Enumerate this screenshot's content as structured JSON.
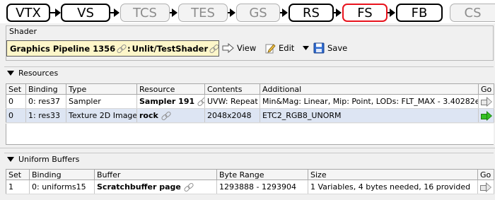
{
  "pipeline": {
    "stages": [
      {
        "label": "VTX",
        "state": "active"
      },
      {
        "label": "VS",
        "state": "active"
      },
      {
        "label": "TCS",
        "state": "inactive"
      },
      {
        "label": "TES",
        "state": "inactive"
      },
      {
        "label": "GS",
        "state": "inactive"
      },
      {
        "label": "RS",
        "state": "active"
      },
      {
        "label": "FS",
        "state": "selected"
      },
      {
        "label": "FB",
        "state": "active"
      },
      {
        "label": "CS",
        "state": "inactive"
      }
    ]
  },
  "shader": {
    "group_label": "Shader",
    "name": "Graphics Pipeline 1356",
    "separator": ": ",
    "shader_name": "Unlit/TestShader",
    "view_label": "View",
    "edit_label": "Edit",
    "save_label": "Save"
  },
  "resources": {
    "title": "Resources",
    "columns": [
      "Set",
      "Binding",
      "Type",
      "Resource",
      "Contents",
      "Additional",
      "Go"
    ],
    "rows": [
      {
        "set": "0",
        "binding": "0: res37",
        "type": "Sampler",
        "resource": "Sampler 191",
        "contents": "UVW: Repeat",
        "additional": "Min&Mag: Linear, Mip: Point, LODs: FLT_MAX - 3.40282e+38",
        "go": "gray"
      },
      {
        "set": "0",
        "binding": "1: res33",
        "type": "Texture 2D Image",
        "resource": "rock",
        "contents": "2048x2048",
        "additional": "ETC2_RGB8_UNORM",
        "go": "green"
      }
    ]
  },
  "uniform_buffers": {
    "title": "Uniform Buffers",
    "columns": [
      "Set",
      "Binding",
      "Buffer",
      "Byte Range",
      "Size",
      "Go"
    ],
    "rows": [
      {
        "set": "1",
        "binding": "0: uniforms15",
        "buffer": "Scratchbuffer page",
        "range": "1293888 - 1293904",
        "size": "1 Variables, 4 bytes needed, 16 provided",
        "go": "gray"
      }
    ]
  }
}
